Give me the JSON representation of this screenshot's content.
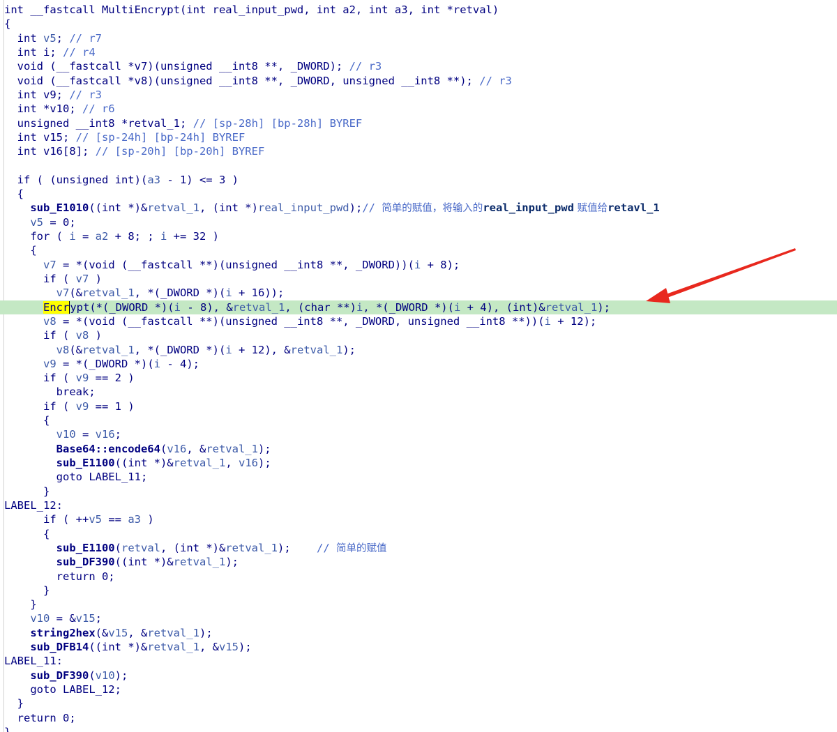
{
  "editor": {
    "accent_colors": {
      "current_line": "#c4e8c4",
      "search_highlight": "#ffff00",
      "annotation_arrow": "#e8281e",
      "plain": "#000080",
      "variable": "#3c5aa8",
      "comment": "#4a6ac8"
    },
    "current_line_index": 21,
    "annotation": {
      "icon": "red-arrow-icon",
      "points_to_line": 21
    },
    "lines": [
      [
        [
          "p",
          "int __fastcall MultiEncrypt(int real_input_pwd, int a2, int a3, int *retval)"
        ]
      ],
      [
        [
          "p",
          "{"
        ]
      ],
      [
        [
          "p",
          "  int "
        ],
        [
          "v",
          "v5"
        ],
        [
          "p",
          "; "
        ],
        [
          "c",
          "// r7"
        ]
      ],
      [
        [
          "p",
          "  int i; "
        ],
        [
          "c",
          "// r4"
        ]
      ],
      [
        [
          "p",
          "  void (__fastcall *v7)(unsigned __int8 **, _DWORD); "
        ],
        [
          "c",
          "// r3"
        ]
      ],
      [
        [
          "p",
          "  void (__fastcall *v8)(unsigned __int8 **, _DWORD, unsigned __int8 **); "
        ],
        [
          "c",
          "// r3"
        ]
      ],
      [
        [
          "p",
          "  int v9; "
        ],
        [
          "c",
          "// r3"
        ]
      ],
      [
        [
          "p",
          "  int *v10; "
        ],
        [
          "c",
          "// r6"
        ]
      ],
      [
        [
          "p",
          "  unsigned __int8 *retval_1; "
        ],
        [
          "c",
          "// [sp-28h] [bp-28h] BYREF"
        ]
      ],
      [
        [
          "p",
          "  int v15; "
        ],
        [
          "c",
          "// [sp-24h] [bp-24h] BYREF"
        ]
      ],
      [
        [
          "p",
          "  int v16[8]; "
        ],
        [
          "c",
          "// [sp-20h] [bp-20h] BYREF"
        ]
      ],
      [
        [
          "p",
          ""
        ]
      ],
      [
        [
          "p",
          "  if ( (unsigned int)("
        ],
        [
          "v",
          "a3"
        ],
        [
          "p",
          " - 1) <= 3 )"
        ]
      ],
      [
        [
          "p",
          "  {"
        ]
      ],
      [
        [
          "p",
          "    "
        ],
        [
          "f",
          "sub_E1010"
        ],
        [
          "p",
          "((int *)&"
        ],
        [
          "v",
          "retval_1"
        ],
        [
          "p",
          ", (int *)"
        ],
        [
          "v",
          "real_input_pwd"
        ],
        [
          "p",
          ");"
        ],
        [
          "c",
          "// "
        ],
        [
          "cj",
          "简单的赋值，将输入的"
        ],
        [
          "cb",
          "real_input_pwd"
        ],
        [
          "cj",
          " 赋值给"
        ],
        [
          "cb",
          "retavl_1"
        ]
      ],
      [
        [
          "p",
          "    "
        ],
        [
          "v",
          "v5"
        ],
        [
          "p",
          " = 0;"
        ]
      ],
      [
        [
          "p",
          "    for ( "
        ],
        [
          "v",
          "i"
        ],
        [
          "p",
          " = "
        ],
        [
          "v",
          "a2"
        ],
        [
          "p",
          " + 8; ; "
        ],
        [
          "v",
          "i"
        ],
        [
          "p",
          " += 32 )"
        ]
      ],
      [
        [
          "p",
          "    {"
        ]
      ],
      [
        [
          "p",
          "      "
        ],
        [
          "v",
          "v7"
        ],
        [
          "p",
          " = *(void (__fastcall **)(unsigned __int8 **, _DWORD))("
        ],
        [
          "v",
          "i"
        ],
        [
          "p",
          " + 8);"
        ]
      ],
      [
        [
          "p",
          "      if ( "
        ],
        [
          "v",
          "v7"
        ],
        [
          "p",
          " )"
        ]
      ],
      [
        [
          "p",
          "        "
        ],
        [
          "v",
          "v7"
        ],
        [
          "p",
          "(&"
        ],
        [
          "v",
          "retval_1"
        ],
        [
          "p",
          ", *(_DWORD *)("
        ],
        [
          "v",
          "i"
        ],
        [
          "p",
          " + 16));"
        ]
      ],
      [
        [
          "p",
          "      "
        ],
        [
          "hl",
          "Encr"
        ],
        [
          "cur",
          "ypt"
        ],
        [
          "p",
          "(*(_DWORD *)("
        ],
        [
          "v",
          "i"
        ],
        [
          "p",
          " - 8), &"
        ],
        [
          "v",
          "retval_1"
        ],
        [
          "p",
          ", (char **)"
        ],
        [
          "v",
          "i"
        ],
        [
          "p",
          ", *(_DWORD *)("
        ],
        [
          "v",
          "i"
        ],
        [
          "p",
          " + 4), (int)&"
        ],
        [
          "v",
          "retval_1"
        ],
        [
          "p",
          ");"
        ]
      ],
      [
        [
          "p",
          "      "
        ],
        [
          "v",
          "v8"
        ],
        [
          "p",
          " = *(void (__fastcall **)(unsigned __int8 **, _DWORD, unsigned __int8 **))("
        ],
        [
          "v",
          "i"
        ],
        [
          "p",
          " + 12);"
        ]
      ],
      [
        [
          "p",
          "      if ( "
        ],
        [
          "v",
          "v8"
        ],
        [
          "p",
          " )"
        ]
      ],
      [
        [
          "p",
          "        "
        ],
        [
          "v",
          "v8"
        ],
        [
          "p",
          "(&"
        ],
        [
          "v",
          "retval_1"
        ],
        [
          "p",
          ", *(_DWORD *)("
        ],
        [
          "v",
          "i"
        ],
        [
          "p",
          " + 12), &"
        ],
        [
          "v",
          "retval_1"
        ],
        [
          "p",
          ");"
        ]
      ],
      [
        [
          "p",
          "      "
        ],
        [
          "v",
          "v9"
        ],
        [
          "p",
          " = *(_DWORD *)("
        ],
        [
          "v",
          "i"
        ],
        [
          "p",
          " - 4);"
        ]
      ],
      [
        [
          "p",
          "      if ( "
        ],
        [
          "v",
          "v9"
        ],
        [
          "p",
          " == 2 )"
        ]
      ],
      [
        [
          "p",
          "        break;"
        ]
      ],
      [
        [
          "p",
          "      if ( "
        ],
        [
          "v",
          "v9"
        ],
        [
          "p",
          " == 1 )"
        ]
      ],
      [
        [
          "p",
          "      {"
        ]
      ],
      [
        [
          "p",
          "        "
        ],
        [
          "v",
          "v10"
        ],
        [
          "p",
          " = "
        ],
        [
          "v",
          "v16"
        ],
        [
          "p",
          ";"
        ]
      ],
      [
        [
          "p",
          "        "
        ],
        [
          "f",
          "Base64::encode64"
        ],
        [
          "p",
          "("
        ],
        [
          "v",
          "v16"
        ],
        [
          "p",
          ", &"
        ],
        [
          "v",
          "retval_1"
        ],
        [
          "p",
          ");"
        ]
      ],
      [
        [
          "p",
          "        "
        ],
        [
          "f",
          "sub_E1100"
        ],
        [
          "p",
          "((int *)&"
        ],
        [
          "v",
          "retval_1"
        ],
        [
          "p",
          ", "
        ],
        [
          "v",
          "v16"
        ],
        [
          "p",
          ");"
        ]
      ],
      [
        [
          "p",
          "        goto LABEL_11;"
        ]
      ],
      [
        [
          "p",
          "      }"
        ]
      ],
      [
        [
          "p",
          "LABEL_12:"
        ]
      ],
      [
        [
          "p",
          "      if ( ++"
        ],
        [
          "v",
          "v5"
        ],
        [
          "p",
          " == "
        ],
        [
          "v",
          "a3"
        ],
        [
          "p",
          " )"
        ]
      ],
      [
        [
          "p",
          "      {"
        ]
      ],
      [
        [
          "p",
          "        "
        ],
        [
          "f",
          "sub_E1100"
        ],
        [
          "p",
          "("
        ],
        [
          "v",
          "retval"
        ],
        [
          "p",
          ", (int *)&"
        ],
        [
          "v",
          "retval_1"
        ],
        [
          "p",
          ");    "
        ],
        [
          "c",
          "// "
        ],
        [
          "cj",
          "简单的赋值"
        ]
      ],
      [
        [
          "p",
          "        "
        ],
        [
          "f",
          "sub_DF390"
        ],
        [
          "p",
          "((int *)&"
        ],
        [
          "v",
          "retval_1"
        ],
        [
          "p",
          ");"
        ]
      ],
      [
        [
          "p",
          "        return 0;"
        ]
      ],
      [
        [
          "p",
          "      }"
        ]
      ],
      [
        [
          "p",
          "    }"
        ]
      ],
      [
        [
          "p",
          "    "
        ],
        [
          "v",
          "v10"
        ],
        [
          "p",
          " = &"
        ],
        [
          "v",
          "v15"
        ],
        [
          "p",
          ";"
        ]
      ],
      [
        [
          "p",
          "    "
        ],
        [
          "f",
          "string2hex"
        ],
        [
          "p",
          "(&"
        ],
        [
          "v",
          "v15"
        ],
        [
          "p",
          ", &"
        ],
        [
          "v",
          "retval_1"
        ],
        [
          "p",
          ");"
        ]
      ],
      [
        [
          "p",
          "    "
        ],
        [
          "f",
          "sub_DFB14"
        ],
        [
          "p",
          "((int *)&"
        ],
        [
          "v",
          "retval_1"
        ],
        [
          "p",
          ", &"
        ],
        [
          "v",
          "v15"
        ],
        [
          "p",
          ");"
        ]
      ],
      [
        [
          "p",
          "LABEL_11:"
        ]
      ],
      [
        [
          "p",
          "    "
        ],
        [
          "f",
          "sub_DF390"
        ],
        [
          "p",
          "("
        ],
        [
          "v",
          "v10"
        ],
        [
          "p",
          ");"
        ]
      ],
      [
        [
          "p",
          "    goto LABEL_12;"
        ]
      ],
      [
        [
          "p",
          "  }"
        ]
      ],
      [
        [
          "p",
          "  return 0;"
        ]
      ],
      [
        [
          "p",
          "}"
        ]
      ]
    ]
  }
}
